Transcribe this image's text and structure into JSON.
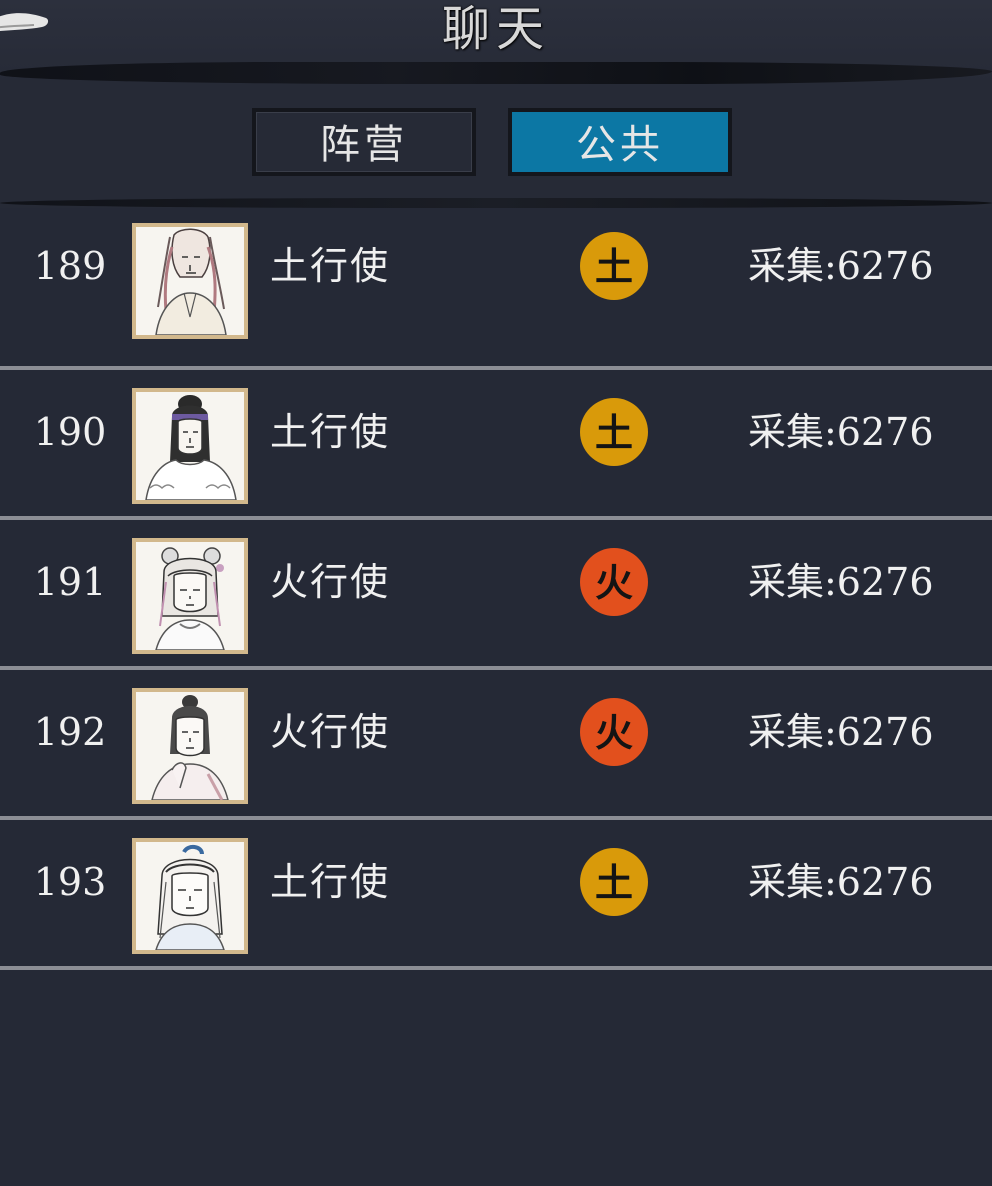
{
  "header": {
    "title": "聊天"
  },
  "tabs": [
    {
      "label": "阵营",
      "active": false
    },
    {
      "label": "公共",
      "active": true
    }
  ],
  "colors": {
    "background": "#252936",
    "tab_active": "#0c77a4",
    "earth": "#d99a0a",
    "fire": "#e2501d",
    "avatar_border": "#d2b88c",
    "separator": "#8c8e95"
  },
  "rows": [
    {
      "rank": "189",
      "avatar_icon": "long-haired-man-portrait-icon",
      "role": "土行使",
      "element": "土",
      "element_type": "earth",
      "stat": "采集:6276"
    },
    {
      "rank": "190",
      "avatar_icon": "fur-collar-woman-portrait-icon",
      "role": "土行使",
      "element": "土",
      "element_type": "earth",
      "stat": "采集:6276"
    },
    {
      "rank": "191",
      "avatar_icon": "hair-ornament-girl-portrait-icon",
      "role": "火行使",
      "element": "火",
      "element_type": "fire",
      "stat": "采集:6276"
    },
    {
      "rank": "192",
      "avatar_icon": "ponytail-man-portrait-icon",
      "role": "火行使",
      "element": "火",
      "element_type": "fire",
      "stat": "采集:6276"
    },
    {
      "rank": "193",
      "avatar_icon": "topknot-youth-portrait-icon",
      "role": "土行使",
      "element": "土",
      "element_type": "earth",
      "stat": "采集:6276"
    }
  ]
}
